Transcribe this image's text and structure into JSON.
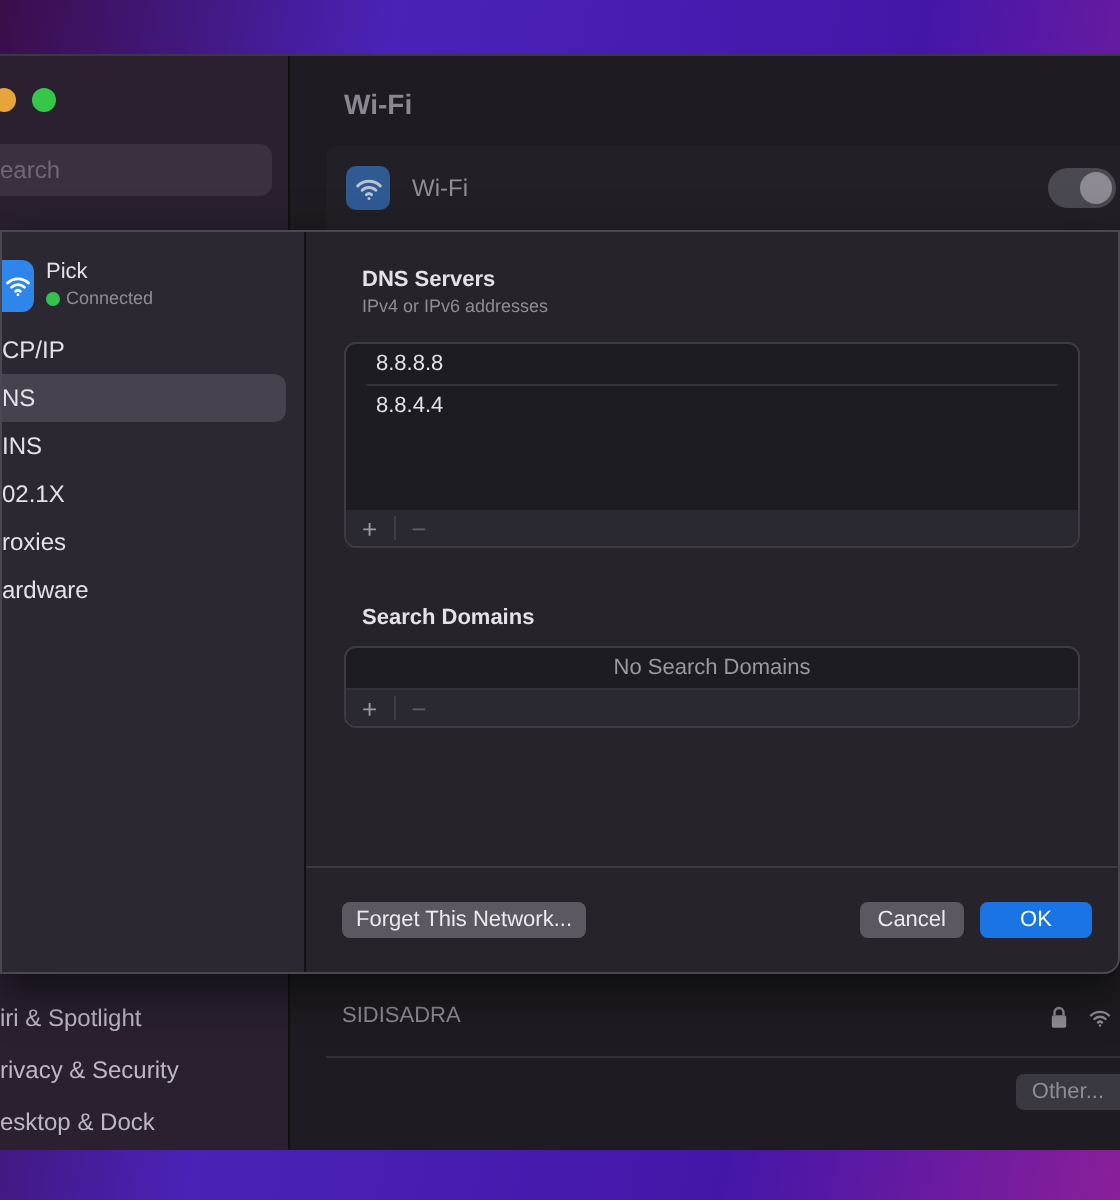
{
  "window": {
    "title": "Wi-Fi",
    "search": {
      "placeholder": "earch"
    },
    "wifi_row": {
      "label": "Wi-Fi",
      "on": true
    },
    "sidebar_items": [
      {
        "label": "iri & Spotlight"
      },
      {
        "label": "rivacy & Security"
      },
      {
        "label": "esktop & Dock"
      }
    ],
    "networks": [
      {
        "name": "SIDISADRA",
        "locked": true
      }
    ],
    "other_button": "Other..."
  },
  "sheet": {
    "network": {
      "name": "Pick",
      "status": "Connected",
      "connected": true
    },
    "tabs": [
      {
        "label": "CP/IP",
        "selected": false
      },
      {
        "label": "NS",
        "selected": true
      },
      {
        "label": "INS",
        "selected": false
      },
      {
        "label": "02.1X",
        "selected": false
      },
      {
        "label": "roxies",
        "selected": false
      },
      {
        "label": "ardware",
        "selected": false
      }
    ],
    "dns_servers": {
      "title": "DNS Servers",
      "subtitle": "IPv4 or IPv6 addresses",
      "entries": [
        "8.8.8.8",
        "8.8.4.4"
      ],
      "add": "+",
      "remove": "−"
    },
    "search_domains": {
      "title": "Search Domains",
      "empty_text": "No Search Domains",
      "add": "+",
      "remove": "−"
    },
    "buttons": {
      "forget": "Forget This Network...",
      "cancel": "Cancel",
      "ok": "OK"
    }
  }
}
